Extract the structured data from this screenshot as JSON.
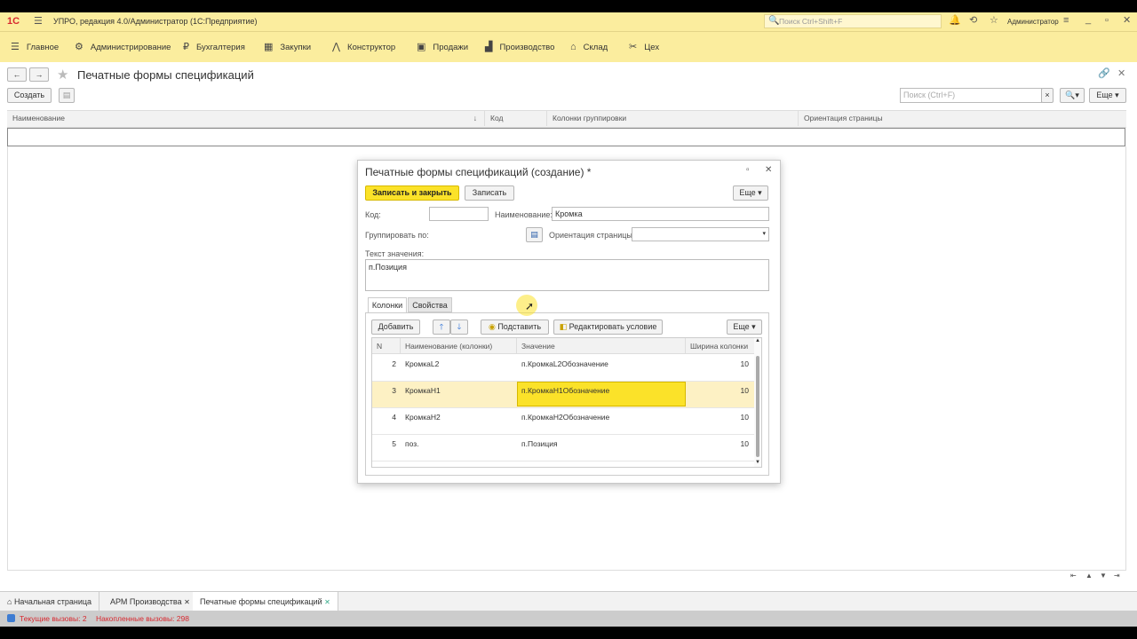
{
  "app": {
    "logo": "1С",
    "title": "УПРО, редакция 4.0/Администратор  (1С:Предприятие)",
    "search_placeholder": "Поиск Ctrl+Shift+F",
    "user": "Администратор"
  },
  "menu": [
    {
      "label": "Главное",
      "icon": "hamburger-icon"
    },
    {
      "label": "Администрирование",
      "icon": "gear-icon"
    },
    {
      "label": "Бухгалтерия",
      "icon": "ruble-icon"
    },
    {
      "label": "Закупки",
      "icon": "cart-icon"
    },
    {
      "label": "Конструктор",
      "icon": "compass-icon"
    },
    {
      "label": "Продажи",
      "icon": "basket-icon"
    },
    {
      "label": "Производство",
      "icon": "factory-icon"
    },
    {
      "label": "Склад",
      "icon": "warehouse-icon"
    },
    {
      "label": "Цех",
      "icon": "tools-icon"
    }
  ],
  "page": {
    "title": "Печатные формы спецификаций",
    "create_label": "Создать",
    "search_placeholder": "Поиск (Ctrl+F)",
    "more_label": "Еще",
    "columns": [
      "Наименование",
      "Код",
      "Колонки группировки",
      "Ориентация страницы"
    ]
  },
  "dialog": {
    "title": "Печатные формы спецификаций (создание) *",
    "save_close_label": "Записать и закрыть",
    "save_label": "Записать",
    "more_label": "Еще",
    "code_label": "Код:",
    "code_value": "",
    "name_label": "Наименование:",
    "name_value": "Кромка",
    "group_label": "Группировать по:",
    "orientation_label": "Ориентация страницы:",
    "orientation_value": "",
    "text_label": "Текст значения:",
    "text_value": "п.Позиция",
    "tabs": [
      "Колонки",
      "Свойства"
    ],
    "add_label": "Добавить",
    "substitute_label": "Подставить",
    "edit_condition_label": "Редактировать условие",
    "grid_more_label": "Еще",
    "grid_columns": [
      "N",
      "Наименование (колонки)",
      "Значение",
      "Ширина колонки"
    ],
    "rows": [
      {
        "n": "2",
        "name": "КромкаL2",
        "value": "п.КромкаL2Обозначение",
        "width": "10"
      },
      {
        "n": "3",
        "name": "КромкаН1",
        "value": "п.КромкаН1Обозначение",
        "width": "10"
      },
      {
        "n": "4",
        "name": "КромкаН2",
        "value": "п.КромкаН2Обозначение",
        "width": "10"
      },
      {
        "n": "5",
        "name": "поз.",
        "value": "п.Позиция",
        "width": "10"
      }
    ]
  },
  "tabs": [
    {
      "label": "Начальная страница"
    },
    {
      "label": "АРМ Производства"
    },
    {
      "label": "Печатные формы спецификаций"
    }
  ],
  "status": {
    "current_calls": "Текущие вызовы: 2",
    "accumulated_calls": "Накопленные вызовы: 298"
  },
  "colors": {
    "accent": "#fbed9e",
    "button": "#fbe229",
    "selected_row": "#fdf1c4",
    "status_red": "#d7282f"
  }
}
